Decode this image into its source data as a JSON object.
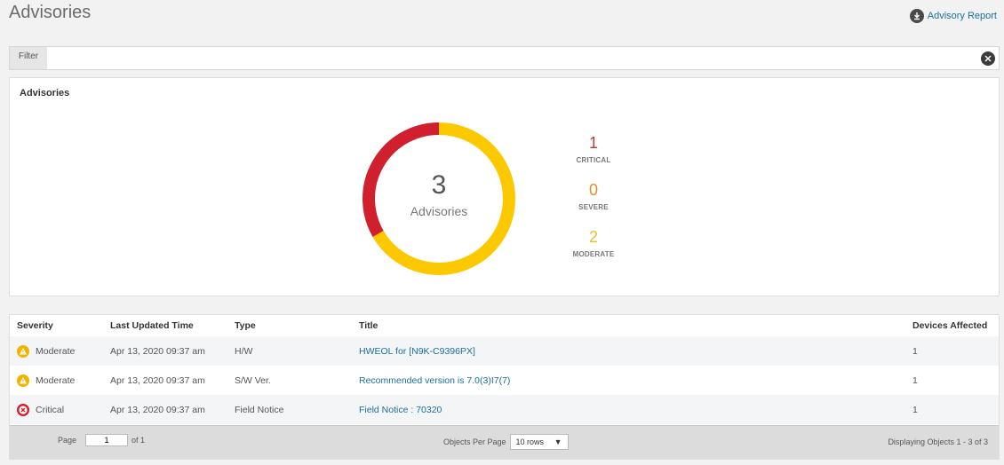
{
  "header": {
    "title": "Advisories",
    "report_link": "Advisory Report"
  },
  "filter": {
    "label": "Filter",
    "value": "",
    "placeholder": ""
  },
  "summary": {
    "title": "Advisories",
    "total": "3",
    "total_label": "Advisories",
    "legend": [
      {
        "count": "1",
        "label": "CRITICAL",
        "color": "#c0392b"
      },
      {
        "count": "0",
        "label": "SEVERE",
        "color": "#e0902a"
      },
      {
        "count": "2",
        "label": "MODERATE",
        "color": "#e8c12a"
      }
    ],
    "ring_colors": {
      "critical": "#d0202e",
      "moderate": "#fcc800"
    }
  },
  "table": {
    "headers": [
      "Severity",
      "Last Updated Time",
      "Type",
      "Title",
      "Devices Affected"
    ],
    "rows": [
      {
        "severity": "Moderate",
        "severity_icon": "warning-icon",
        "updated": "Apr 13, 2020 09:37 am",
        "type": "H/W",
        "title": "HWEOL for [N9K-C9396PX]",
        "devices": "1"
      },
      {
        "severity": "Moderate",
        "severity_icon": "warning-icon",
        "updated": "Apr 13, 2020 09:37 am",
        "type": "S/W Ver.",
        "title": "Recommended version is 7.0(3)I7(7)",
        "devices": "1"
      },
      {
        "severity": "Critical",
        "severity_icon": "critical-icon",
        "updated": "Apr 13, 2020 09:37 am",
        "type": "Field Notice",
        "title": "Field Notice : 70320",
        "devices": "1"
      }
    ]
  },
  "pager": {
    "page_label": "Page",
    "page_value": "1",
    "of_label": "of 1",
    "per_page_label": "Objects Per Page",
    "per_page_value": "10 rows",
    "display_text": "Displaying Objects 1 - 3 of 3"
  }
}
